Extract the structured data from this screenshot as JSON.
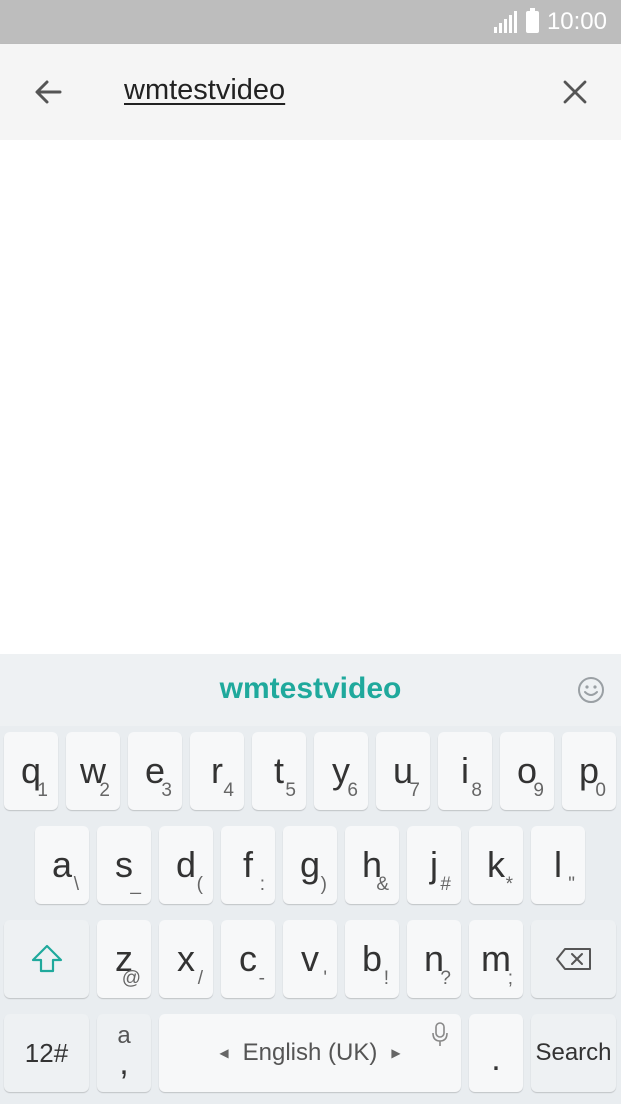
{
  "status_bar": {
    "time": "10:00"
  },
  "search": {
    "query": "wmtestvideo"
  },
  "keyboard": {
    "suggestion": "wmtestvideo",
    "row1": [
      {
        "main": "q",
        "sub": "1"
      },
      {
        "main": "w",
        "sub": "2"
      },
      {
        "main": "e",
        "sub": "3"
      },
      {
        "main": "r",
        "sub": "4"
      },
      {
        "main": "t",
        "sub": "5"
      },
      {
        "main": "y",
        "sub": "6"
      },
      {
        "main": "u",
        "sub": "7"
      },
      {
        "main": "i",
        "sub": "8"
      },
      {
        "main": "o",
        "sub": "9"
      },
      {
        "main": "p",
        "sub": "0"
      }
    ],
    "row2": [
      {
        "main": "a",
        "sub": "\\"
      },
      {
        "main": "s",
        "sub": "_"
      },
      {
        "main": "d",
        "sub": "("
      },
      {
        "main": "f",
        "sub": ":"
      },
      {
        "main": "g",
        "sub": ")"
      },
      {
        "main": "h",
        "sub": "&"
      },
      {
        "main": "j",
        "sub": "#"
      },
      {
        "main": "k",
        "sub": "*"
      },
      {
        "main": "l",
        "sub": "\""
      }
    ],
    "row3": [
      {
        "main": "z",
        "sub": "@"
      },
      {
        "main": "x",
        "sub": "/"
      },
      {
        "main": "c",
        "sub": "-"
      },
      {
        "main": "v",
        "sub": "'"
      },
      {
        "main": "b",
        "sub": "!"
      },
      {
        "main": "n",
        "sub": "?"
      },
      {
        "main": "m",
        "sub": ";"
      }
    ],
    "symbols_label": "12#",
    "comma_key": {
      "main": ",",
      "sub": "a"
    },
    "space_label": "English (UK)",
    "period_label": ".",
    "action_label": "Search"
  },
  "colors": {
    "accent": "#1fa99c",
    "status_bar": "#bdbdbd"
  },
  "icons": [
    "signal-icon",
    "battery-icon",
    "back-arrow-icon",
    "close-icon",
    "emoji-icon",
    "shift-icon",
    "backspace-icon",
    "microphone-icon"
  ]
}
